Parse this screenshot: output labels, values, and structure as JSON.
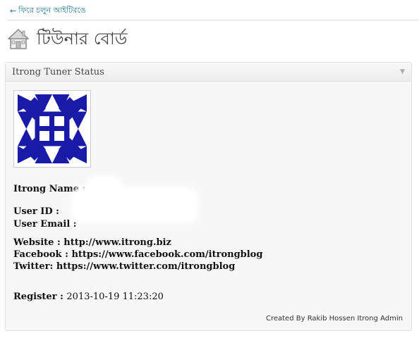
{
  "nav": {
    "back_arrow": "←",
    "back_label": "ফিরে চলুন আইটিরঙে"
  },
  "page": {
    "title": "টিউনার বোর্ড",
    "icon": "house-icon"
  },
  "box": {
    "title": "Itrong Tuner Status",
    "toggle_glyph": "▼",
    "avatar_color": "#1a1aa8"
  },
  "profile": {
    "name_label": "Itrong Name :",
    "name_value": "",
    "user_id_label": "User ID :",
    "user_id_value": "",
    "email_label": "User Email :",
    "email_value": "",
    "website_label": "Website :",
    "website_value": "http://www.itrong.biz",
    "facebook_label": "Facebook :",
    "facebook_value": "https://www.facebook.com/itrongblog",
    "twitter_label": "Twitter:",
    "twitter_value": "https://www.twitter.com/itrongblog",
    "register_label": "Register :",
    "register_value": "2013-10-19 11:23:20"
  },
  "footer": {
    "credit": "Created By Rakib Hossen Itrong Admin"
  }
}
